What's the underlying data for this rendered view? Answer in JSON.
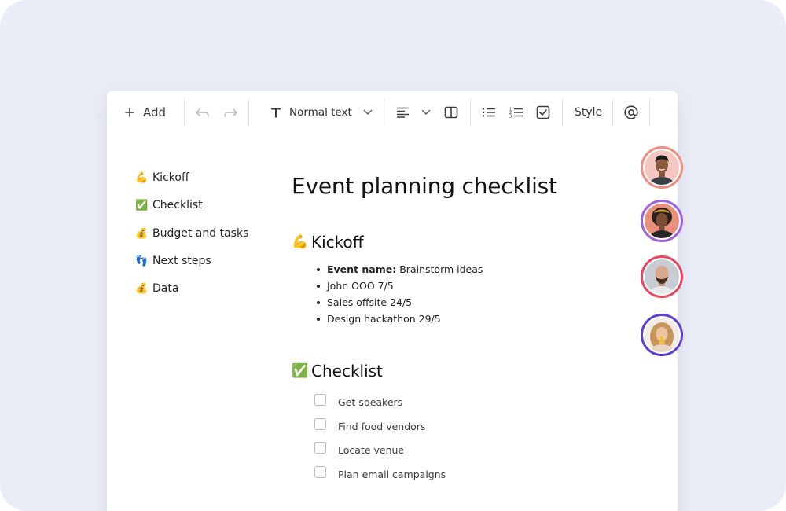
{
  "toolbar": {
    "add_label": "Add",
    "text_style_label": "Normal text",
    "style_label": "Style",
    "icons": [
      "plus-icon",
      "undo-icon",
      "redo-icon",
      "text-format-icon",
      "chevron-down-icon",
      "align-left-icon",
      "layout-columns-icon",
      "bulleted-list-icon",
      "numbered-list-icon",
      "checkbox-icon",
      "at-mention-icon"
    ]
  },
  "outline": [
    {
      "emoji": "💪",
      "label": "Kickoff"
    },
    {
      "emoji": "✅",
      "label": "Checklist"
    },
    {
      "emoji": "💰",
      "label": "Budget and tasks"
    },
    {
      "emoji": "👣",
      "label": "Next steps"
    },
    {
      "emoji": "💰",
      "label": "Data"
    }
  ],
  "document": {
    "title": "Event planning checklist",
    "kickoff": {
      "emoji": "💪",
      "heading": "Kickoff",
      "bullets": [
        {
          "bold": "Event name:",
          "text": "Brainstorm ideas"
        },
        {
          "bold": "",
          "text": "John OOO 7/5"
        },
        {
          "bold": "",
          "text": "Sales offsite 24/5"
        },
        {
          "bold": "",
          "text": "Design hackathon 29/5"
        }
      ]
    },
    "checklist": {
      "emoji": "✅",
      "heading": "Checklist",
      "items": [
        {
          "label": "Get speakers",
          "checked": false
        },
        {
          "label": "Find food vendors",
          "checked": false
        },
        {
          "label": "Locate venue",
          "checked": false
        },
        {
          "label": "Plan email campaigns",
          "checked": false
        }
      ]
    }
  },
  "collaborators": [
    {
      "ring_color": "#f28b82"
    },
    {
      "ring_color": "#a05fe0"
    },
    {
      "ring_color": "#e8455f"
    },
    {
      "ring_color": "#5b3fd6"
    }
  ],
  "colors": {
    "background": "#eaedf7",
    "card": "#ffffff",
    "text": "#1f1f1f"
  }
}
